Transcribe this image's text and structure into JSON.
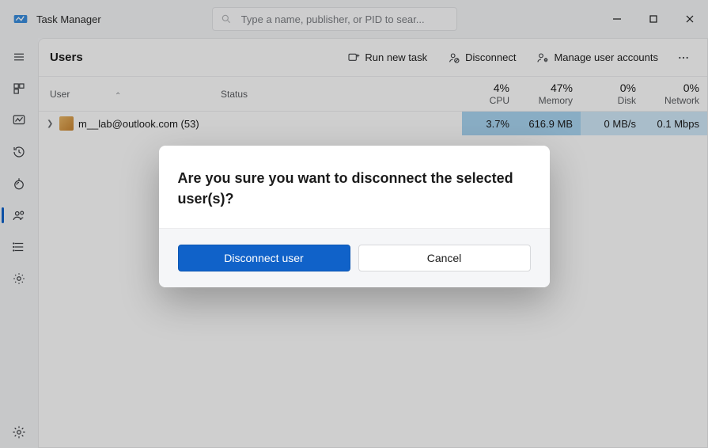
{
  "app": {
    "title": "Task Manager"
  },
  "search": {
    "placeholder": "Type a name, publisher, or PID to sear..."
  },
  "page": {
    "title": "Users"
  },
  "toolbar": {
    "run_new_task": "Run new task",
    "disconnect": "Disconnect",
    "manage_accounts": "Manage user accounts"
  },
  "columns": {
    "user": "User",
    "status": "Status",
    "cpu": {
      "pct": "4%",
      "label": "CPU"
    },
    "memory": {
      "pct": "47%",
      "label": "Memory"
    },
    "disk": {
      "pct": "0%",
      "label": "Disk"
    },
    "network": {
      "pct": "0%",
      "label": "Network"
    }
  },
  "rows": [
    {
      "user": "m__lab@outlook.com (53)",
      "status": "",
      "cpu": "3.7%",
      "memory": "616.9 MB",
      "disk": "0 MB/s",
      "network": "0.1 Mbps"
    }
  ],
  "dialog": {
    "message": "Are you sure you want to disconnect the selected user(s)?",
    "primary": "Disconnect user",
    "secondary": "Cancel"
  },
  "sidebar_icons": [
    "hamburger-icon",
    "processes-icon",
    "performance-icon",
    "history-icon",
    "startup-icon",
    "users-icon",
    "details-icon",
    "services-icon"
  ]
}
